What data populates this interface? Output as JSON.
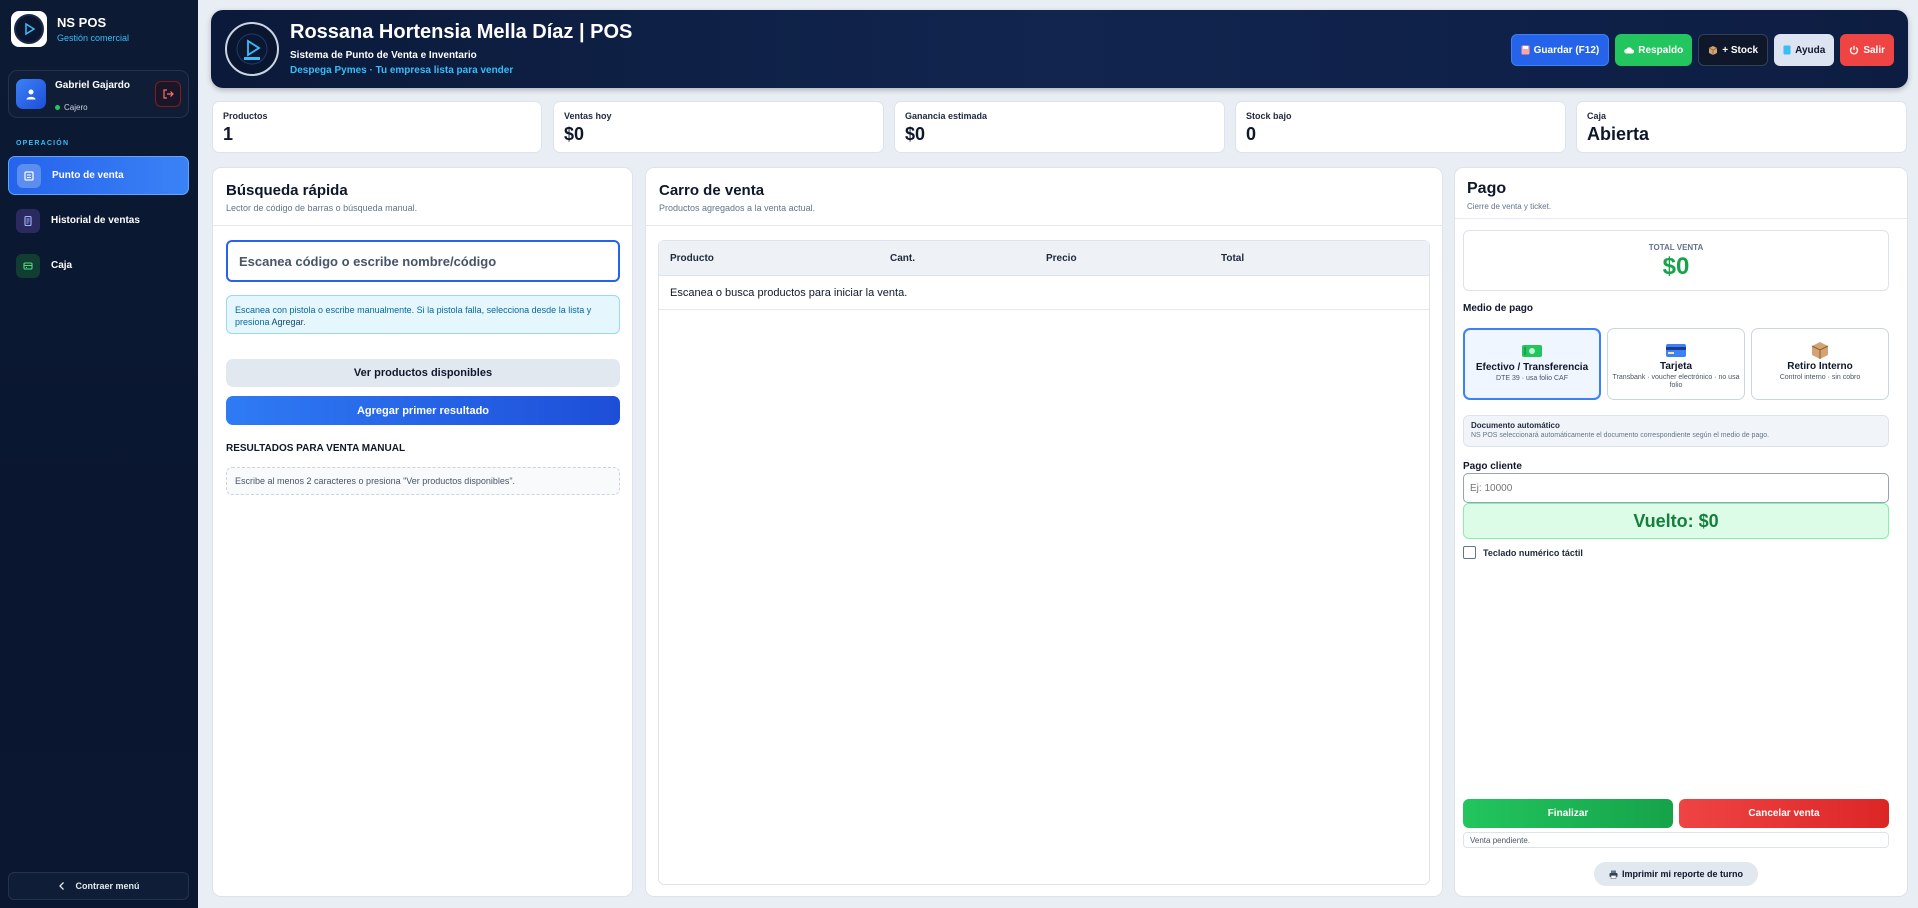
{
  "sidebar": {
    "brand_title": "NS POS",
    "brand_subtitle": "Gestión comercial",
    "user_name": "Gabriel Gajardo",
    "user_role": "Cajero",
    "section_label": "OPERACIÓN",
    "items": [
      {
        "label": "Punto de venta",
        "icon": "pos-icon",
        "active": true
      },
      {
        "label": "Historial de ventas",
        "icon": "history-icon",
        "active": false
      },
      {
        "label": "Caja",
        "icon": "cash-register-icon",
        "active": false
      }
    ],
    "collapse_label": "Contraer menú"
  },
  "header": {
    "title": "Rossana Hortensia Mella Díaz | POS",
    "subtitle": "Sistema de Punto de Venta e Inventario",
    "tagline": "Despega Pymes · Tu empresa lista para vender",
    "buttons": {
      "save": "Guardar (F12)",
      "backup": "Respaldo",
      "stock": "+ Stock",
      "help": "Ayuda",
      "exit": "Salir"
    }
  },
  "stats": [
    {
      "label": "Productos",
      "value": "1"
    },
    {
      "label": "Ventas hoy",
      "value": "$0"
    },
    {
      "label": "Ganancia estimada",
      "value": "$0"
    },
    {
      "label": "Stock bajo",
      "value": "0"
    },
    {
      "label": "Caja",
      "value": "Abierta"
    }
  ],
  "search": {
    "title": "Búsqueda rápida",
    "subtitle": "Lector de código de barras o búsqueda manual.",
    "placeholder": "Escanea código o escribe nombre/código",
    "hint_text": "Escanea con pistola o escribe manualmente. Si la pistola falla, selecciona desde la lista y presiona",
    "hint_link": "Agregar",
    "hint_end": ".",
    "view_products": "Ver productos disponibles",
    "add_first": "Agregar primer resultado",
    "results_title": "RESULTADOS PARA VENTA MANUAL",
    "results_empty": "Escribe al menos 2 caracteres o presiona \"Ver productos disponibles\"."
  },
  "cart": {
    "title": "Carro de venta",
    "subtitle": "Productos agregados a la venta actual.",
    "columns": [
      "Producto",
      "Cant.",
      "Precio",
      "Total"
    ],
    "empty": "Escanea o busca productos para iniciar la venta."
  },
  "payment": {
    "title": "Pago",
    "subtitle": "Cierre de venta y ticket.",
    "total_label": "TOTAL VENTA",
    "total_value": "$0",
    "method_label": "Medio de pago",
    "methods": [
      {
        "name": "Efectivo / Transferencia",
        "desc": "DTE 39 · usa folio CAF",
        "selected": true
      },
      {
        "name": "Tarjeta",
        "desc": "Transbank · voucher electrónico · no usa folio",
        "selected": false
      },
      {
        "name": "Retiro Interno",
        "desc": "Control interno · sin cobro",
        "selected": false
      }
    ],
    "doc_title": "Documento automático",
    "doc_desc": "NS POS seleccionará automáticamente el documento correspondiente según el medio de pago.",
    "client_label": "Pago cliente",
    "client_placeholder": "Ej: 10000",
    "change": "Vuelto: $0",
    "keyboard_label": "Teclado numérico táctil",
    "finalize": "Finalizar",
    "cancel": "Cancelar venta",
    "status": "Venta pendiente.",
    "print": "Imprimir mi reporte de turno"
  }
}
